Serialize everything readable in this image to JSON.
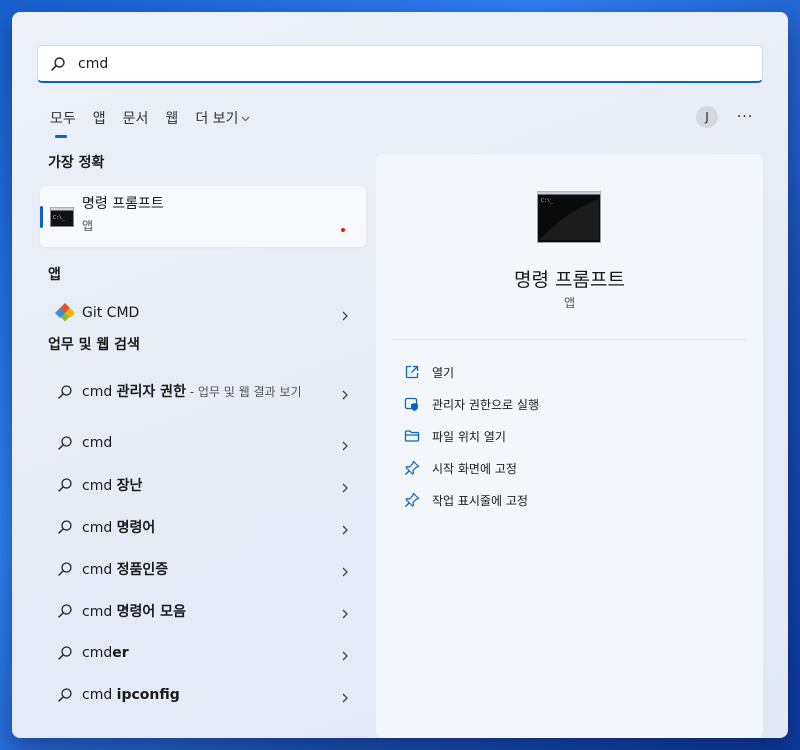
{
  "search": {
    "value": "cmd"
  },
  "tabs": [
    {
      "label": "모두"
    },
    {
      "label": "앱"
    },
    {
      "label": "문서"
    },
    {
      "label": "웹"
    },
    {
      "label": "더 보기"
    }
  ],
  "account": {
    "initial": "J",
    "more_label": "···"
  },
  "left": {
    "best_match_heading": "가장 정확",
    "best_match": {
      "title": "명령 프롬프트",
      "subtitle": "앱"
    },
    "apps_heading": "앱",
    "apps": [
      {
        "label": "Git CMD"
      }
    ],
    "web_heading": "업무 및 웹 검색",
    "web_results": [
      {
        "prefix": "cmd ",
        "bold": "관리자 권한",
        "suffix": " - 업무 및 웹 결과 보기"
      },
      {
        "prefix": "cmd",
        "bold": "",
        "suffix": ""
      },
      {
        "prefix": "cmd ",
        "bold": "장난",
        "suffix": ""
      },
      {
        "prefix": "cmd ",
        "bold": "명령어",
        "suffix": ""
      },
      {
        "prefix": "cmd ",
        "bold": "정품인증",
        "suffix": ""
      },
      {
        "prefix": "cmd ",
        "bold": "명령어 모음",
        "suffix": ""
      },
      {
        "prefix": "cmd",
        "bold": "er",
        "suffix": ""
      },
      {
        "prefix": "cmd ",
        "bold": "ipconfig",
        "suffix": ""
      }
    ]
  },
  "detail": {
    "title": "명령 프롬프트",
    "subtitle": "앱",
    "actions": [
      {
        "label": "열기",
        "icon": "open-external-icon"
      },
      {
        "label": "관리자 권한으로 실행",
        "icon": "run-as-admin-icon"
      },
      {
        "label": "파일 위치 열기",
        "icon": "folder-icon"
      },
      {
        "label": "시작 화면에 고정",
        "icon": "pin-icon"
      },
      {
        "label": "작업 표시줄에 고정",
        "icon": "pin-icon"
      }
    ]
  },
  "colors": {
    "accent": "#0a64c2",
    "background": "#1a5fd0",
    "panel": "#e6ecf6"
  }
}
